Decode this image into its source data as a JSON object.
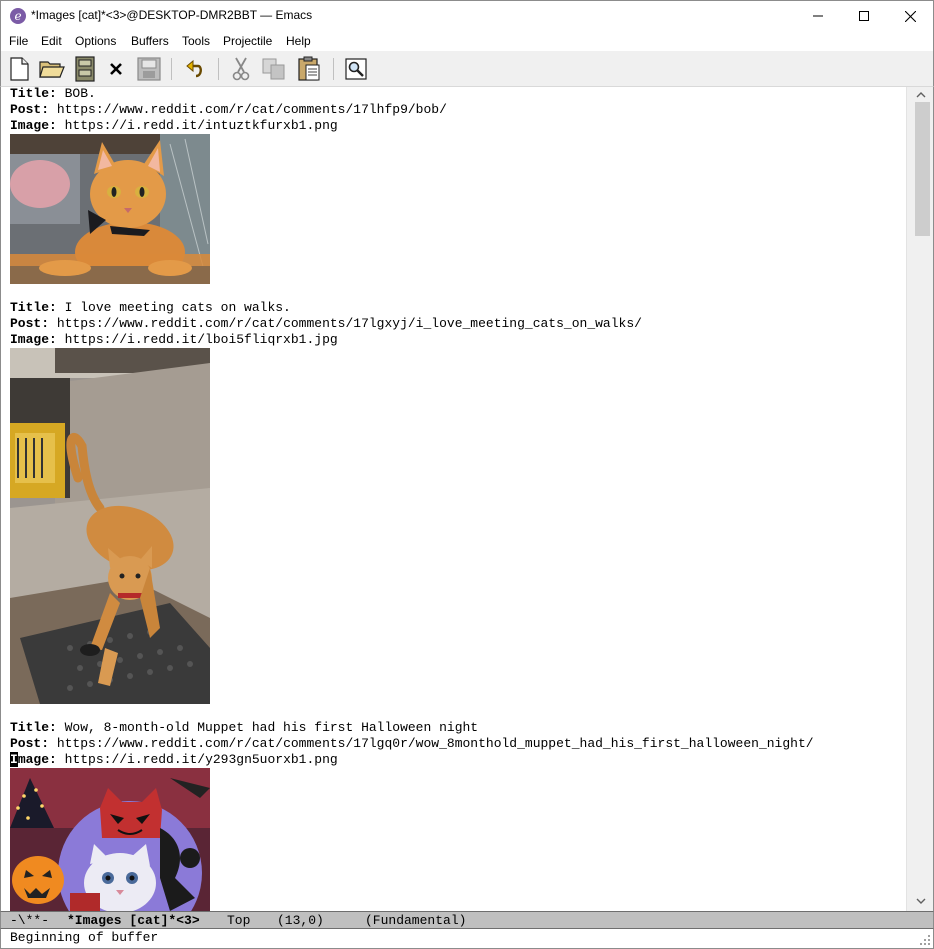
{
  "window": {
    "title": "*Images [cat]*<3>@DESKTOP-DMR2BBT — Emacs",
    "app_icon_glyph": "e"
  },
  "menu": {
    "items": [
      {
        "label": "File"
      },
      {
        "label": "Edit"
      },
      {
        "label": "Options"
      },
      {
        "label": "Buffers"
      },
      {
        "label": "Tools"
      },
      {
        "label": "Projectile"
      },
      {
        "label": "Help"
      }
    ]
  },
  "toolbar": {
    "icons": [
      "new-file-icon",
      "open-folder-icon",
      "open-directory-icon",
      "close-buffer-icon",
      "save-icon",
      "undo-icon",
      "cut-icon",
      "copy-icon",
      "paste-icon",
      "search-icon"
    ]
  },
  "buffer": {
    "labels": {
      "title": "Title:",
      "post": "Post:",
      "image": "Image:"
    },
    "entries": [
      {
        "title": "BOB.",
        "post": "https://www.reddit.com/r/cat/comments/17lhfp9/bob/",
        "image": "https://i.redd.it/intuztkfurxb1.png"
      },
      {
        "title": "I love meeting cats on walks.",
        "post": "https://www.reddit.com/r/cat/comments/17lgxyj/i_love_meeting_cats_on_walks/",
        "image": "https://i.redd.it/lboi5fliqrxb1.jpg"
      },
      {
        "title": "Wow, 8-month-old Muppet had his first Halloween night",
        "post": "https://www.reddit.com/r/cat/comments/17lgq0r/wow_8monthold_muppet_had_his_first_halloween_night/",
        "image_cursor_char": "I",
        "image_label_rest": "mage:",
        "image": "https://i.redd.it/y293gn5uorxb1.png"
      }
    ]
  },
  "modeline": {
    "status": "-\\**-",
    "buffer_name": "*Images [cat]*<3>",
    "position": "Top",
    "line_col": "(13,0)",
    "mode": "(Fundamental)"
  },
  "echo": {
    "message": "Beginning of buffer"
  },
  "colors": {
    "modeline_bg": "#bfbfbf",
    "toolbar_bg": "#f0f0f0",
    "emacs_purple": "#7b5ba6"
  }
}
